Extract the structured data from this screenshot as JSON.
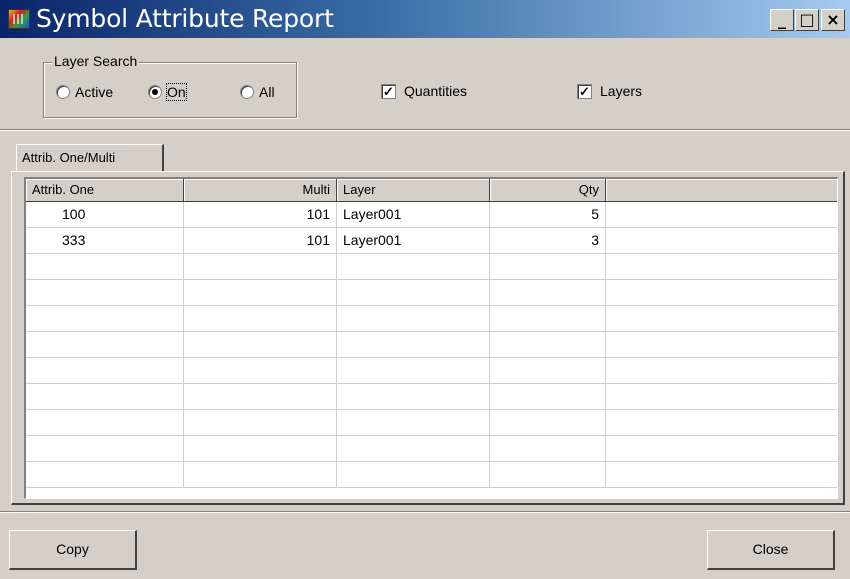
{
  "window": {
    "title": "Symbol Attribute Report",
    "minimize": "_",
    "maximize": "□",
    "close": "×"
  },
  "layer_search": {
    "legend": "Layer Search",
    "options": [
      {
        "label": "Active",
        "selected": false
      },
      {
        "label": "On",
        "selected": true
      },
      {
        "label": "All",
        "selected": false
      }
    ]
  },
  "checkboxes": {
    "quantities": {
      "label": "Quantities",
      "checked": true
    },
    "layers": {
      "label": "Layers",
      "checked": true
    }
  },
  "tabs": [
    {
      "label": "Attrib. One/Multi"
    }
  ],
  "table": {
    "columns": [
      "Attrib. One",
      "Multi",
      "Layer",
      "Qty",
      ""
    ],
    "rows": [
      [
        "100",
        "101",
        "Layer001",
        "5",
        ""
      ],
      [
        "333",
        "101",
        "Layer001",
        "3",
        ""
      ]
    ]
  },
  "buttons": {
    "copy": "Copy",
    "close": "Close"
  }
}
